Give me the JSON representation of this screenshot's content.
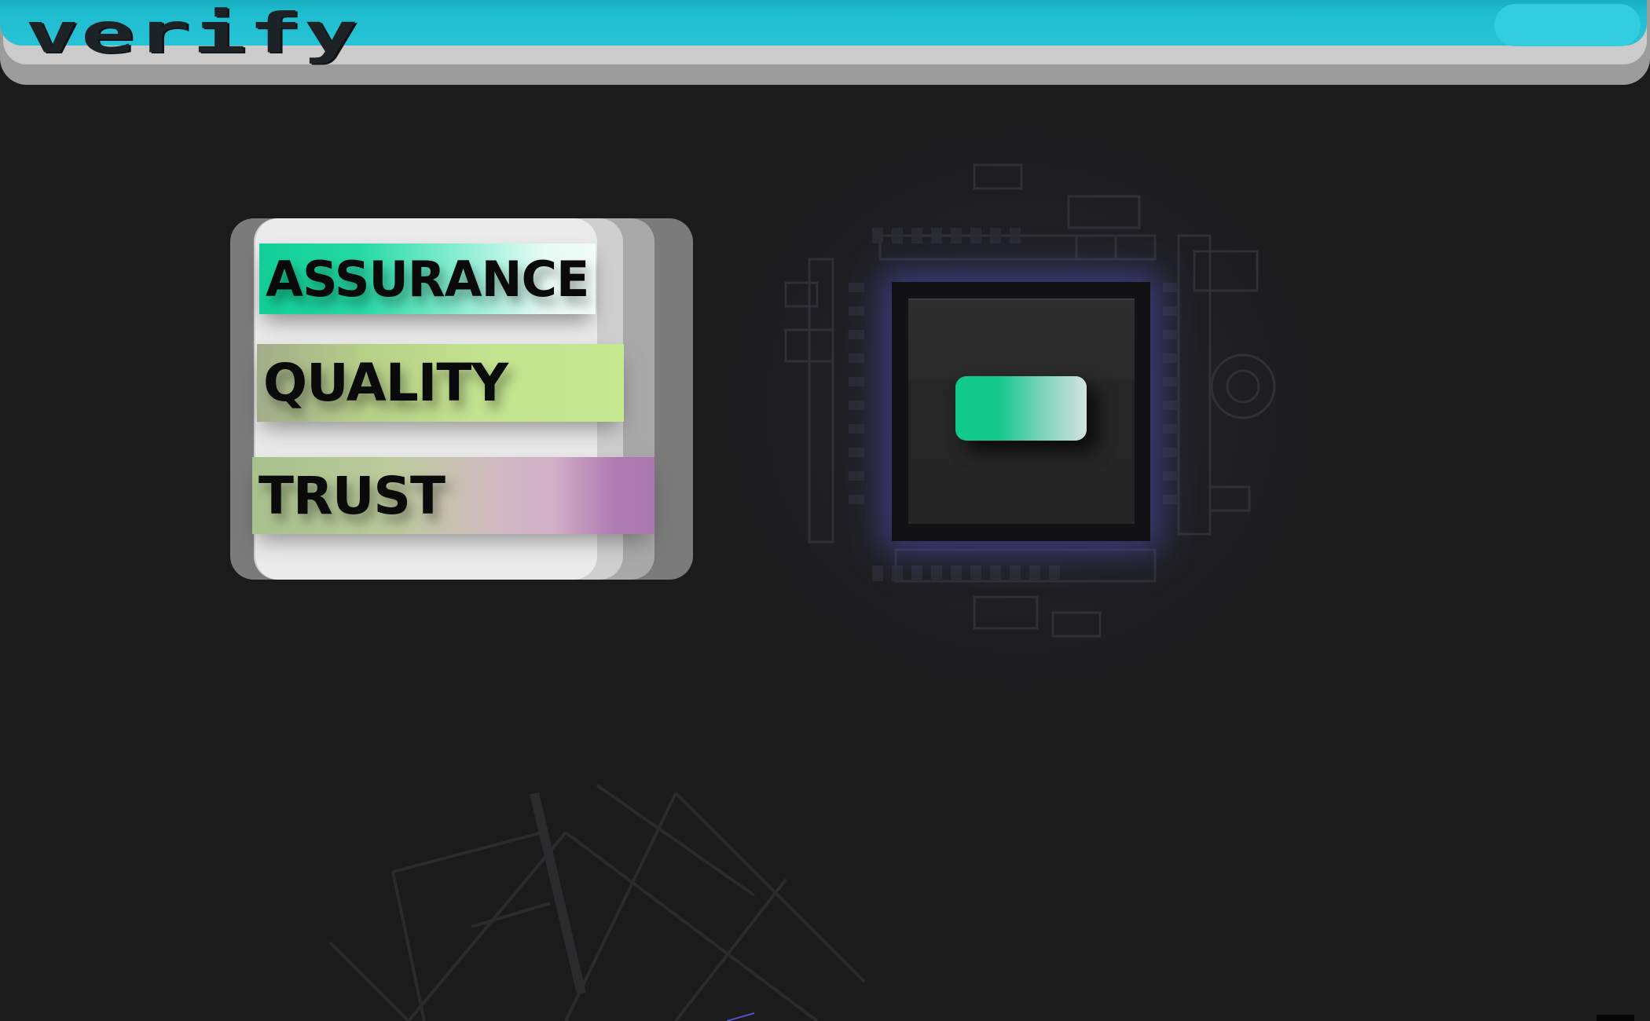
{
  "header": {
    "logo_text": "verify",
    "accent_color": "#27c3d6"
  },
  "values_card": {
    "items": [
      {
        "label": "ASSURANCE",
        "color": "#11cf96"
      },
      {
        "label": "QUALITY",
        "color": "#c2e28f"
      },
      {
        "label": "TRUST",
        "color": "#ac78b0"
      }
    ]
  },
  "device_panel": {
    "glow_color": "#5454c8",
    "button_color": "#0fcb8b"
  },
  "background": {
    "color": "#1b1b1c",
    "decor": [
      "circuit-board-graphic",
      "line-grid-graphic"
    ]
  }
}
